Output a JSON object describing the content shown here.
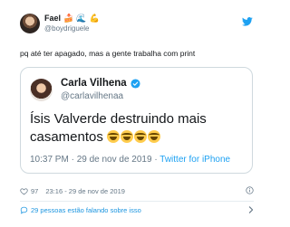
{
  "tweet": {
    "author_name": "Fael",
    "author_emojis": [
      "🍰",
      "🌊",
      "💪"
    ],
    "author_handle": "@boydriguele",
    "text": "pq até ter apagado, mas a gente trabalha com print",
    "likes": "97",
    "timestamp": "23:16 - 29 de nov de 2019",
    "talking": "29 pessoas estão falando sobre isso"
  },
  "quoted": {
    "author_name": "Carla Vilhena",
    "author_handle": "@carlavilhenaa",
    "text": "Ísis Valverde destruindo mais casamentos",
    "time": "10:37 PM · 29 de nov de 2019",
    "client": "Twitter for iPhone"
  },
  "colors": {
    "accent": "#1da1f2",
    "muted": "#657786",
    "border": "#cfd9de"
  },
  "icons": [
    "twitter-bird-icon",
    "verified-badge-icon",
    "heart-icon",
    "info-icon",
    "comment-icon",
    "chevron-right-icon",
    "laughing-emoji-icon"
  ]
}
